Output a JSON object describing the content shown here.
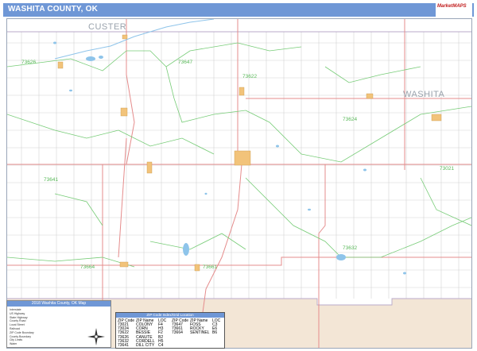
{
  "title": "WASHITA COUNTY, OK",
  "logo": {
    "name": "MarketMAPS"
  },
  "county_labels": {
    "north": "CUSTER",
    "east": "WASHITA"
  },
  "zip_labels": [
    {
      "code": "73626"
    },
    {
      "code": "73647"
    },
    {
      "code": "73622"
    },
    {
      "code": "73624"
    },
    {
      "code": "73641"
    },
    {
      "code": "73021"
    },
    {
      "code": "73632"
    },
    {
      "code": "73664"
    },
    {
      "code": "73661"
    }
  ],
  "legend": {
    "title": "2018 Washita County, OK Map",
    "rows": [
      "Interstate",
      "US Highway",
      "State Highway",
      "County Road",
      "Local Street",
      "Railroad",
      "ZIP Code Boundary",
      "County Boundary",
      "City Limits",
      "Water"
    ]
  },
  "zip_table": {
    "title": "ZIP Code Index/Grid Location",
    "headers": [
      "ZIP Code",
      "ZIP Name",
      "LOC",
      "ZIP Code",
      "ZIP Name",
      "LOC"
    ],
    "left": [
      [
        "73021",
        "COLONY",
        "F4"
      ],
      [
        "73024",
        "CORN",
        "H3"
      ],
      [
        "73622",
        "BESSIE",
        "F2"
      ],
      [
        "73626",
        "CANUTE",
        "B2"
      ],
      [
        "73632",
        "CORDELL",
        "H5"
      ],
      [
        "73641",
        "DILL CITY",
        "C4"
      ]
    ],
    "right": [
      [
        "73647",
        "FOSS",
        "C3"
      ],
      [
        "73661",
        "ROCKY",
        "E6"
      ],
      [
        "73664",
        "SENTINEL",
        "B6"
      ]
    ]
  },
  "colors": {
    "title_bar": "#6f97d6",
    "highway": "#e58c8c",
    "zip_boundary": "#77cc77",
    "water": "#8ec4ea",
    "city": "#f2c37a",
    "grid": "#c8c8c8"
  }
}
